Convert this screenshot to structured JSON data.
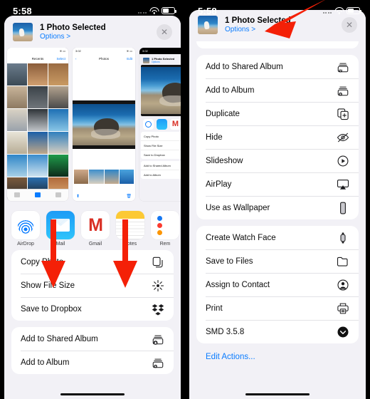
{
  "meta": {
    "accent_blue": "#0a7cff",
    "arrow_red": "#f42007",
    "sheet_bg": "#f2f1f6",
    "row_bg": "#ffffff"
  },
  "left_panel": {
    "statusbar": {
      "time": "5:58",
      "wifi_icon": "wifi-icon",
      "battery_icon": "battery-icon",
      "signal_icon": "cellular-dots-icon"
    },
    "header": {
      "title": "1 Photo Selected",
      "options": "Options",
      "options_chevron": ">",
      "close_icon": "close-icon",
      "thumbnail": "photo-thumbnail"
    },
    "preview": {
      "cards": [
        {
          "name": "photos-grid-screenshot",
          "time": "",
          "nav_title": "Recents",
          "nav_right": "Select",
          "tabs": [
            "For You",
            "Albums",
            "Search"
          ]
        },
        {
          "name": "photo-detail-screenshot",
          "time": "3:02",
          "nav_title": "Photos",
          "nav_right": "Edit",
          "tabs": []
        },
        {
          "name": "share-sheet-screenshot",
          "time": "3:02",
          "nav_title": "1 Photo Selected",
          "nav_right": "Options",
          "tabs": []
        }
      ]
    },
    "apps": [
      {
        "label": "AirDrop",
        "icon": "airdrop-icon"
      },
      {
        "label": "Mail",
        "icon": "mail-icon"
      },
      {
        "label": "Gmail",
        "icon": "gmail-icon"
      },
      {
        "label": "Notes",
        "icon": "notes-icon"
      },
      {
        "label": "Rem",
        "icon": "reminders-icon"
      }
    ],
    "action_groups": [
      {
        "rows": [
          {
            "label": "Copy Photo",
            "icon": "copy-icon"
          },
          {
            "label": "Show File Size",
            "icon": "sparkle-icon"
          },
          {
            "label": "Save to Dropbox",
            "icon": "dropbox-icon"
          }
        ]
      },
      {
        "rows": [
          {
            "label": "Add to Shared Album",
            "icon": "shared-album-icon"
          },
          {
            "label": "Add to Album",
            "icon": "add-album-icon"
          }
        ]
      }
    ],
    "arrows": [
      {
        "name": "arrow-down-copy-photo",
        "direction": "down"
      },
      {
        "name": "arrow-down-save-dropbox",
        "direction": "down"
      }
    ]
  },
  "right_panel": {
    "statusbar": {
      "time": "5:58",
      "wifi_icon": "wifi-icon",
      "battery_icon": "battery-icon",
      "signal_icon": "cellular-dots-icon"
    },
    "header": {
      "title": "1 Photo Selected",
      "options": "Options",
      "options_chevron": ">",
      "close_icon": "close-icon",
      "thumbnail": "photo-thumbnail"
    },
    "action_groups": [
      {
        "partial": true,
        "rows": []
      },
      {
        "rows": [
          {
            "label": "Add to Shared Album",
            "icon": "shared-album-icon"
          },
          {
            "label": "Add to Album",
            "icon": "add-album-icon"
          },
          {
            "label": "Duplicate",
            "icon": "duplicate-icon"
          },
          {
            "label": "Hide",
            "icon": "eye-slash-icon"
          },
          {
            "label": "Slideshow",
            "icon": "play-circle-icon"
          },
          {
            "label": "AirPlay",
            "icon": "airplay-icon"
          },
          {
            "label": "Use as Wallpaper",
            "icon": "wallpaper-icon"
          }
        ]
      },
      {
        "rows": [
          {
            "label": "Create Watch Face",
            "icon": "watch-icon"
          },
          {
            "label": "Save to Files",
            "icon": "folder-icon"
          },
          {
            "label": "Assign to Contact",
            "icon": "contact-icon"
          },
          {
            "label": "Print",
            "icon": "printer-icon"
          },
          {
            "label": "SMD 3.5.8",
            "icon": "download-circle-icon"
          }
        ]
      }
    ],
    "edit_actions": "Edit Actions...",
    "arrows": [
      {
        "name": "arrow-diagonal-create-watch-face",
        "direction": "down-left"
      }
    ]
  }
}
